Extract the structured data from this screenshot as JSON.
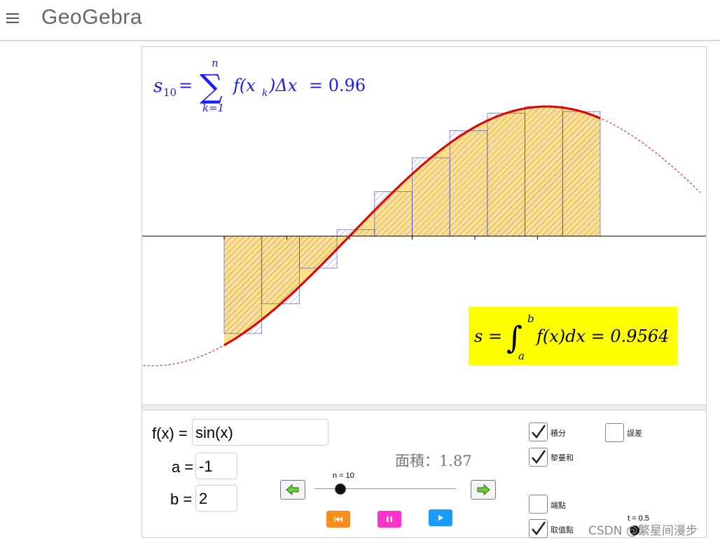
{
  "app": {
    "logo_text": "GeoGebra"
  },
  "graph": {
    "function_color": "#e00000",
    "fill_color": "#ffe08a",
    "hatch_color": "#3333cc",
    "sum_formula": {
      "symbol": "s",
      "subscript": "10",
      "sum_upper": "n",
      "sum_lower": "k=1",
      "body": "f(x",
      "body_sub": "k",
      "body_tail": ")Δx",
      "equals": "= 0.96",
      "eq": "="
    },
    "integral_formula": {
      "lhs": "s =",
      "upper": "b",
      "lower": "a",
      "body": "f(x)dx = 0.9564",
      "bg_color": "#ffff00"
    }
  },
  "inputs": {
    "f_label": "f(x) =",
    "f_value": "sin(x)",
    "a_label": "a =",
    "a_value": "-1",
    "b_label": "b =",
    "b_value": "2"
  },
  "area_text": "面積：1.87",
  "slider_n": {
    "label": "n = 10",
    "value": 10
  },
  "slider_t": {
    "label": "t = 0.5",
    "value": 0.5
  },
  "buttons": {
    "prev_icon": "left-arrow-icon",
    "next_icon": "right-arrow-icon",
    "reset_color": "#ff8c1a",
    "pause_color": "#ff33cc",
    "play_color": "#1a9cff"
  },
  "checkboxes": [
    {
      "label": "積分",
      "checked": true
    },
    {
      "label": "誤差",
      "checked": false
    },
    {
      "label": "黎曼和",
      "checked": true
    },
    {
      "label": "端點",
      "checked": false
    },
    {
      "label": "取值點",
      "checked": true
    }
  ],
  "watermark": "CSDN @繁星间漫步"
}
